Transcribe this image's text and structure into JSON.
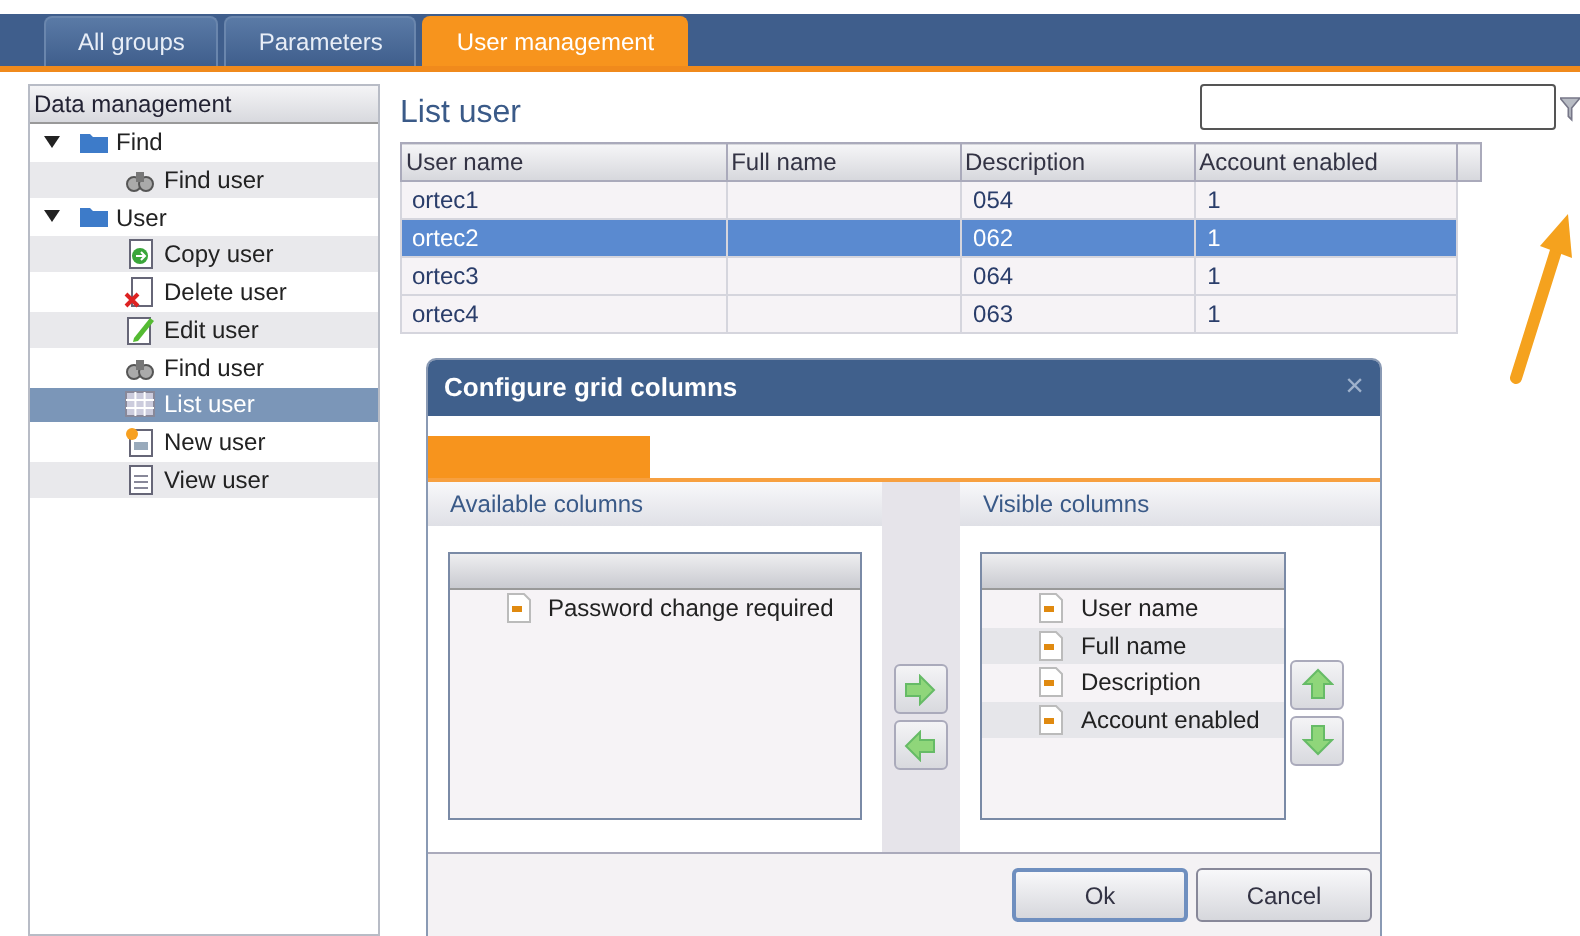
{
  "tabs": [
    {
      "label": "All groups",
      "selected": false
    },
    {
      "label": "Parameters",
      "selected": false
    },
    {
      "label": "User management",
      "selected": true
    }
  ],
  "sidebar": {
    "title": "Data management",
    "items": [
      {
        "label": "Find",
        "kind": "folder",
        "expanded": true,
        "selected": false,
        "children": [
          {
            "label": "Find user",
            "kind": "find",
            "selected": false
          }
        ]
      },
      {
        "label": "User",
        "kind": "folder",
        "expanded": true,
        "selected": false,
        "children": [
          {
            "label": "Copy user",
            "kind": "copy",
            "selected": false
          },
          {
            "label": "Delete user",
            "kind": "delete",
            "selected": false
          },
          {
            "label": "Edit user",
            "kind": "edit",
            "selected": false
          },
          {
            "label": "Find user",
            "kind": "find",
            "selected": false
          },
          {
            "label": "List user",
            "kind": "list",
            "selected": true
          },
          {
            "label": "New user",
            "kind": "new",
            "selected": false
          },
          {
            "label": "View user",
            "kind": "view",
            "selected": false
          }
        ]
      }
    ]
  },
  "main": {
    "title": "List user",
    "table": {
      "columns": [
        "User name",
        "Full name",
        "Description",
        "Account enabled",
        ""
      ],
      "rows": [
        {
          "cells": [
            "ortec1",
            "",
            "054",
            "1"
          ],
          "selected": false
        },
        {
          "cells": [
            "ortec2",
            "",
            "062",
            "1"
          ],
          "selected": true
        },
        {
          "cells": [
            "ortec3",
            "",
            "064",
            "1"
          ],
          "selected": false
        },
        {
          "cells": [
            "ortec4",
            "",
            "063",
            "1"
          ],
          "selected": false
        }
      ]
    }
  },
  "dialog": {
    "title": "Configure grid columns",
    "close": "×",
    "available": {
      "title": "Available columns",
      "items": [
        {
          "label": "Password change required",
          "selected": false
        }
      ]
    },
    "visible": {
      "title": "Visible columns",
      "items": [
        {
          "label": "User name",
          "selected": false
        },
        {
          "label": "Full name",
          "selected": false
        },
        {
          "label": "Description",
          "selected": false
        },
        {
          "label": "Account enabled",
          "selected": false
        }
      ]
    },
    "buttons": [
      {
        "label": "Ok",
        "kind": "default"
      },
      {
        "label": "Cancel",
        "kind": "normal"
      }
    ]
  }
}
